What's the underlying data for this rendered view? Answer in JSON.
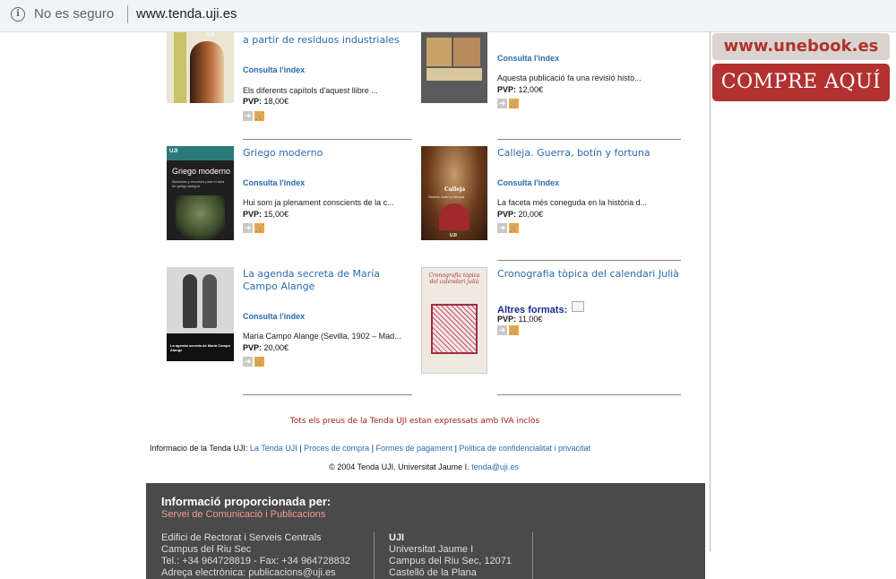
{
  "browser": {
    "security_label": "No es seguro",
    "url": "www.tenda.uji.es"
  },
  "books": [
    {
      "title": "a partir de residuos industriales",
      "consult_label": "Consulta l'index",
      "description": "Els diferents capítols d'aquest llibre ...",
      "price_label": "PVP:",
      "price": "18,00€"
    },
    {
      "title": "",
      "consult_label": "Consulta l'index",
      "description": "Aquesta publicació fa una revisió histo...",
      "price_label": "PVP:",
      "price": "12,00€"
    },
    {
      "title": "Griego moderno",
      "consult_label": "Consulta l'index",
      "description": "Hui som ja plenament conscients de la c...",
      "price_label": "PVP:",
      "price": "15,00€"
    },
    {
      "title": "Calleja. Guerra, botín y fortuna",
      "consult_label": "Consulta l'index",
      "description": "La faceta més coneguda en la història d...",
      "price_label": "PVP:",
      "price": "20,00€"
    },
    {
      "title": "La agenda secreta de María Campo Alange",
      "consult_label": "Consulta l'index",
      "description": "María Campo Alange (Sevilla, 1902 – Mad...",
      "price_label": "PVP:",
      "price": "20,00€"
    },
    {
      "title": "Cronografia tòpica del calendari Julià",
      "other_formats_label": "Altres formats:",
      "price_label": "PVP:",
      "price": "11,00€"
    }
  ],
  "cover_text": {
    "griego_title": "Griego moderno",
    "griego_subtitle": "Nociones y recursos para el aula de griego antiguo",
    "calleja_title": "Calleja",
    "calleja_subtitle": "Guerra, botín y fortuna",
    "agenda_title": "La agenda secreta de María Campo Alange",
    "crono_title": "Cronografia tòpica del calendari julià",
    "uji_logo": "UJI"
  },
  "banners": {
    "unebook": "www.unebook.es",
    "compre": "COMPRE AQUÍ"
  },
  "iva_note": "Tots els preus de la Tenda UJI estan expressats amb IVA inclòs",
  "footer": {
    "info_prefix": "Informacio de la Tenda UJI:",
    "links": [
      "La Tenda UJI",
      "Proces de compra",
      "Formes de pagament",
      "Politica de confidencialitat i privacitat"
    ],
    "copyright": "© 2004 Tenda UJI. Universitat Jaume I.",
    "email": "tenda@uji.es"
  },
  "info_panel": {
    "heading": "Informació proporcionada per:",
    "subheading": "Servei de Comunicació i Publicacions",
    "col1": [
      "Edifici de Rectorat i Serveis Centrals",
      "Campus del Riu Sec",
      "Tel.: +34 964728819 - Fax: +34 964728832",
      "Adreça electrònica: publicacions@uji.es"
    ],
    "col2": [
      "UJI",
      "Universitat Jaume I",
      "Campus del Riu Sec, 12071",
      "Castelló de la Plana"
    ]
  },
  "colors": {
    "link": "#2a6ab0",
    "compre_bg": "#b23131",
    "panel_bg": "#4a4a4a"
  }
}
